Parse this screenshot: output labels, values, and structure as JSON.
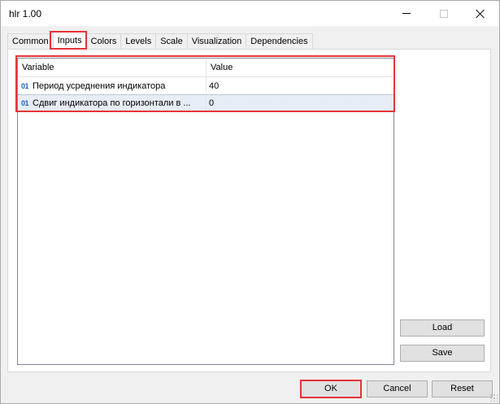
{
  "window": {
    "title": "hlr 1.00"
  },
  "tabs": [
    {
      "label": "Common"
    },
    {
      "label": "Inputs"
    },
    {
      "label": "Colors"
    },
    {
      "label": "Levels"
    },
    {
      "label": "Scale"
    },
    {
      "label": "Visualization"
    },
    {
      "label": "Dependencies"
    }
  ],
  "active_tab": "Inputs",
  "inputs_grid": {
    "headers": {
      "variable": "Variable",
      "value": "Value"
    },
    "rows": [
      {
        "type_icon": "01",
        "variable": "Период усреднения индикатора",
        "value": "40"
      },
      {
        "type_icon": "01",
        "variable": "Сдвиг индикатора по горизонтали в ...",
        "value": "0"
      }
    ]
  },
  "side_buttons": {
    "load": "Load",
    "save": "Save"
  },
  "footer_buttons": {
    "ok": "OK",
    "cancel": "Cancel",
    "reset": "Reset"
  },
  "colors": {
    "highlight": "#e8333a",
    "type_icon": "#1e63b8",
    "selected_row": "#e7edf6"
  }
}
